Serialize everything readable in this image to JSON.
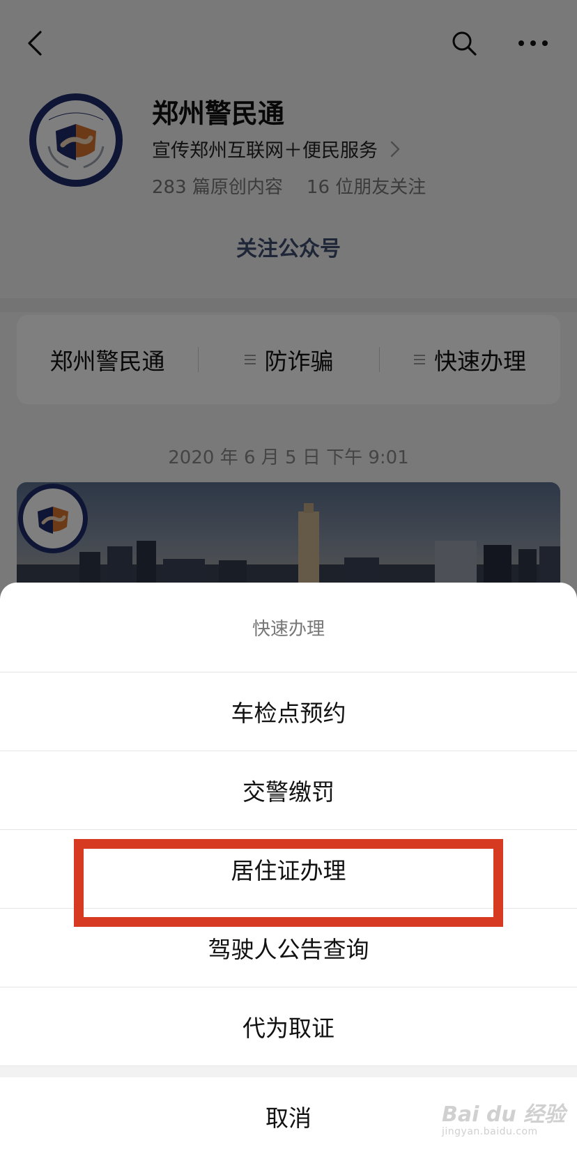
{
  "account": {
    "name": "郑州警民通",
    "description": "宣传郑州互联网＋便民服务",
    "original_count": "283 篇原创内容",
    "friends_following": "16 位朋友关注",
    "follow_label": "关注公众号",
    "avatar_text": "郑州警民通"
  },
  "menu": [
    {
      "label": "郑州警民通",
      "has_submenu": false
    },
    {
      "label": "防诈骗",
      "has_submenu": true
    },
    {
      "label": "快速办理",
      "has_submenu": true
    }
  ],
  "timestamp": "2020 年 6 月 5 日  下午 9:01",
  "action_sheet": {
    "title": "快速办理",
    "options": [
      {
        "label": "车检点预约"
      },
      {
        "label": "交警缴罚"
      },
      {
        "label": "居住证办理"
      },
      {
        "label": "驾驶人公告查询"
      },
      {
        "label": "代为取证"
      }
    ],
    "cancel_label": "取消",
    "highlighted_option": "居住证办理"
  },
  "watermark": {
    "main": "Bai du 经验",
    "sub": "jingyan.baidu.com"
  },
  "colors": {
    "accent": "#3d4c6e",
    "highlight": "#d63a21",
    "badge_navy": "#1f2c6b",
    "badge_orange": "#d9742e"
  }
}
